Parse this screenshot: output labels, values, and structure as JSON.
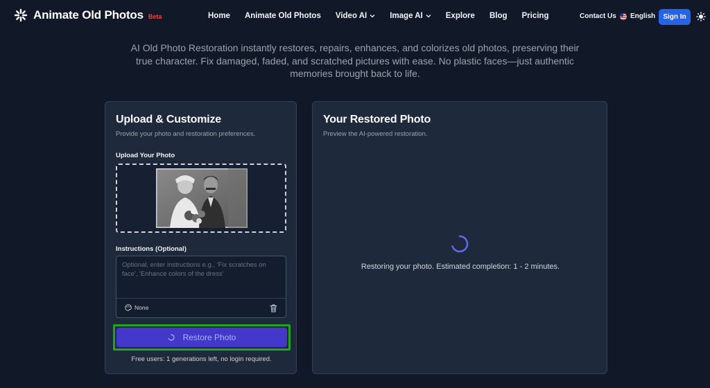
{
  "nav": {
    "logo_text": "Animate Old Photos",
    "beta_badge": "Beta",
    "menu": [
      {
        "label": "Home"
      },
      {
        "label": "Animate Old Photos"
      },
      {
        "label": "Video AI"
      },
      {
        "label": "Image AI"
      },
      {
        "label": "Explore"
      },
      {
        "label": "Blog"
      },
      {
        "label": "Pricing"
      }
    ],
    "contact": "Contact Us",
    "language": "English",
    "signin": "Sign In"
  },
  "intro": {
    "text": "AI Old Photo Restoration instantly restores, repairs, enhances, and colorizes old photos, preserving their true character. Fix damaged, faded, and scratched pictures with ease. No plastic faces—just authentic memories brought back to life."
  },
  "upload_card": {
    "title": "Upload & Customize",
    "subtitle": "Provide your photo and restoration preferences.",
    "upload_label": "Upload Your Photo",
    "instructions_label": "Instructions (Optional)",
    "instructions_placeholder": "Optional, enter instructions e.g., 'Fix scratches on face', 'Enhance colors of the dress'",
    "instructions_value": "",
    "style_value": "None",
    "restore_button": "Restore Photo",
    "free_note": "Free users: 1 generations left, no login required."
  },
  "result_card": {
    "title": "Your Restored Photo",
    "subtitle": "Preview the AI-powered restoration.",
    "status": "Restoring your photo. Estimated completion: 1 - 2 minutes."
  },
  "colors": {
    "background": "#111827",
    "card": "#1e293b",
    "accent": "#4338ca",
    "signin": "#2563eb",
    "highlight": "#22a322",
    "beta": "#ef4444"
  }
}
